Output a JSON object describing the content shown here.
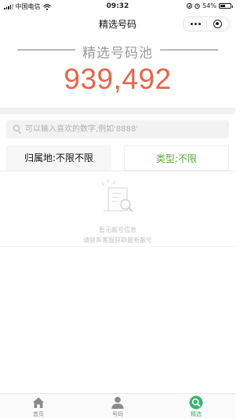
{
  "status_bar": {
    "carrier": "中国电信",
    "time": "09:32",
    "battery": "54%",
    "battery_level": 0.54,
    "icons": [
      "signal-icon",
      "wifi-icon",
      "location-icon",
      "alarm-icon",
      "battery-icon"
    ]
  },
  "nav": {
    "title": "精选号码",
    "icons": [
      "more-icon",
      "close-target-icon"
    ]
  },
  "hero": {
    "subtitle": "精选号码池",
    "count": "939,492",
    "count_color": "#e5654a"
  },
  "search": {
    "placeholder": "可以输入喜欢的数字,例如'8888'",
    "value": "",
    "icon": "search-icon"
  },
  "filters": {
    "region_label": "归属地:不限不限",
    "type_label": "类型:不限",
    "type_color": "#5aaa3a"
  },
  "empty_state": {
    "icon": "empty-document-icon",
    "title": "暂无靓号信息",
    "hint": "请联系客服获取最新靓号"
  },
  "tabbar": {
    "active_color": "#3cb371",
    "items": [
      {
        "label": "首页",
        "icon": "home-icon",
        "active": false
      },
      {
        "label": "号码",
        "icon": "person-icon",
        "active": false
      },
      {
        "label": "精选",
        "icon": "search-icon",
        "active": true
      }
    ]
  }
}
